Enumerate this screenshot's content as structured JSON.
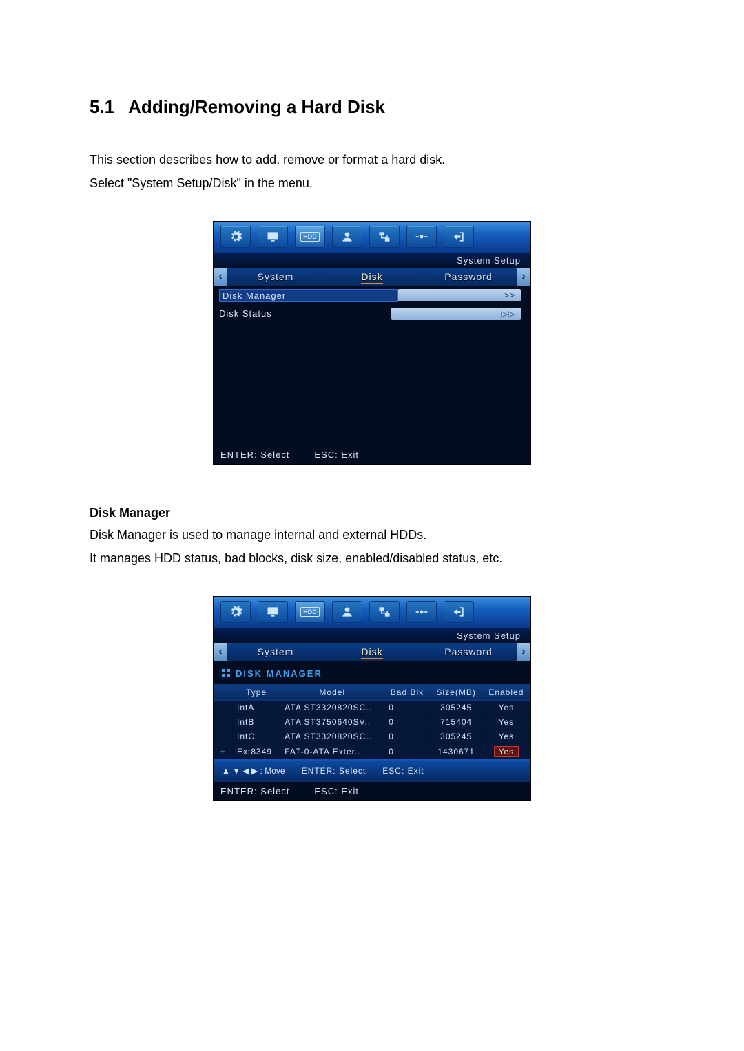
{
  "heading": {
    "number": "5.1",
    "title": "Adding/Removing a Hard Disk"
  },
  "intro": [
    "This section describes how to add, remove or format a hard disk.",
    "Select \"System Setup/Disk\" in the menu."
  ],
  "sub": {
    "title": "Disk Manager",
    "lines": [
      "Disk Manager is used to manage internal and external HDDs.",
      "It manages HDD status, bad blocks, disk size, enabled/disabled status, etc."
    ]
  },
  "dvr": {
    "crumb": "System Setup",
    "tabs": {
      "left": "System",
      "mid": "Disk",
      "right": "Password"
    },
    "footer": {
      "enter": "ENTER: Select",
      "esc": "ESC: Exit"
    }
  },
  "fig1": {
    "rows": [
      {
        "label": "Disk Manager",
        "value": ">>",
        "selected": true
      },
      {
        "label": "Disk Status",
        "value": "▷▷",
        "selected": false
      }
    ]
  },
  "fig2": {
    "panel_title": "DISK MANAGER",
    "headers": [
      "",
      "Type",
      "Model",
      "Bad Blk",
      "Size(MB)",
      "Enabled"
    ],
    "rows": [
      {
        "plus": "",
        "type": "IntA",
        "model": "ATA ST3320820SC..",
        "bad": "0",
        "size": "305245",
        "enabled": "Yes",
        "hl": false
      },
      {
        "plus": "",
        "type": "IntB",
        "model": "ATA ST3750640SV..",
        "bad": "0",
        "size": "715404",
        "enabled": "Yes",
        "hl": false
      },
      {
        "plus": "",
        "type": "IntC",
        "model": "ATA ST3320820SC..",
        "bad": "0",
        "size": "305245",
        "enabled": "Yes",
        "hl": false
      },
      {
        "plus": "+",
        "type": "Ext8349",
        "model": "FAT-0-ATA Exter..",
        "bad": "0",
        "size": "1430671",
        "enabled": "Yes",
        "hl": true
      }
    ],
    "nav": {
      "move": "▲ ▼ ◀ ▶ : Move",
      "enter": "ENTER: Select",
      "esc": "ESC: Exit"
    }
  },
  "icons": {
    "toolbar": [
      "gear-icon",
      "display-icon",
      "hdd-icon",
      "user-icon",
      "network-icon",
      "system-icon",
      "exit-icon"
    ]
  }
}
